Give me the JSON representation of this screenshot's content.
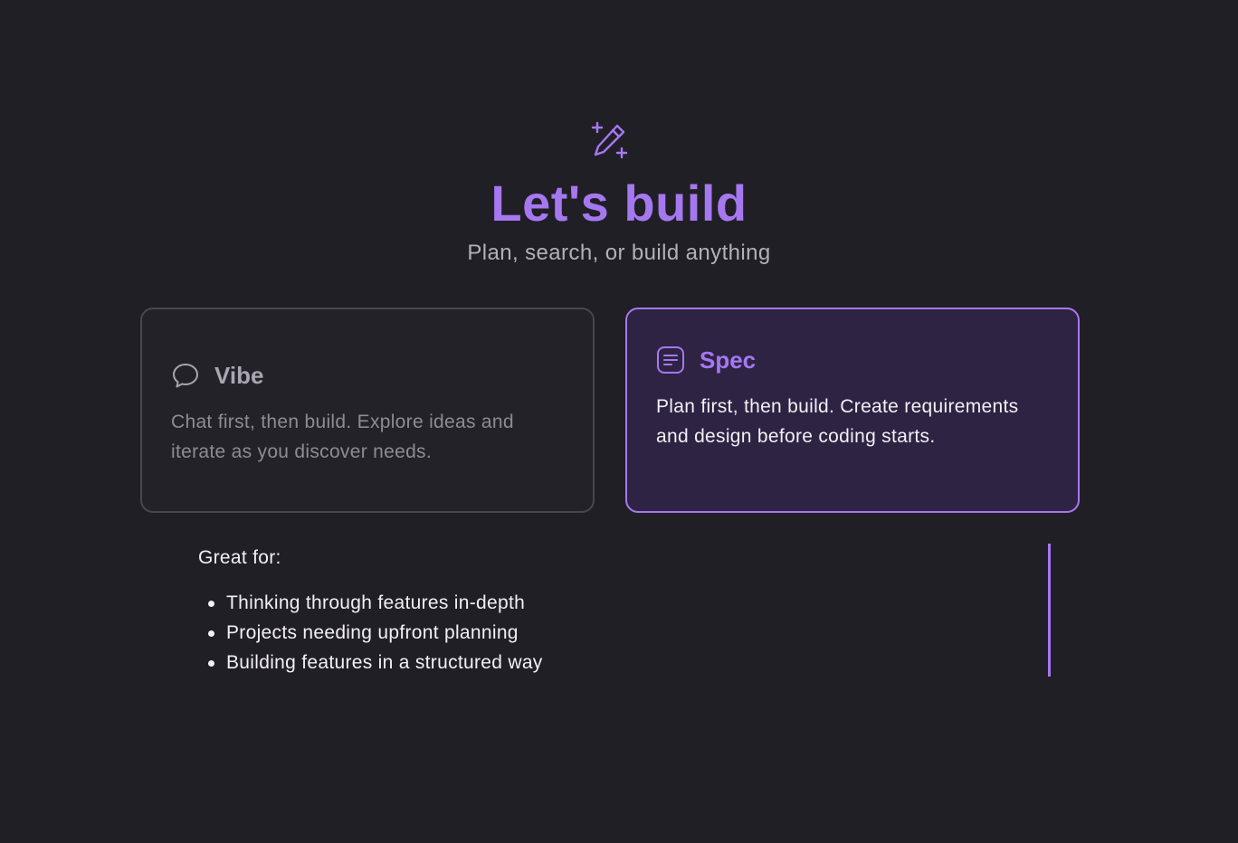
{
  "hero": {
    "icon": "magic-wand-sparkle-icon",
    "title": "Let's build",
    "subtitle": "Plan, search, or build anything"
  },
  "modes": {
    "vibe": {
      "icon": "chat-bubble-icon",
      "title": "Vibe",
      "description": "Chat first, then build. Explore ideas and iterate as you discover needs.",
      "selected": false
    },
    "spec": {
      "icon": "document-lines-icon",
      "title": "Spec",
      "description": "Plan first, then build. Create requirements and design before coding starts.",
      "selected": true
    }
  },
  "details": {
    "heading": "Great for:",
    "items": [
      "Thinking through features in-depth",
      "Projects needing upfront planning",
      "Building features in a structured way"
    ]
  },
  "colors": {
    "background": "#211f26",
    "accent": "#a678f0",
    "selected_card_bg": "#2f2343",
    "unselected_border": "#49464f"
  }
}
